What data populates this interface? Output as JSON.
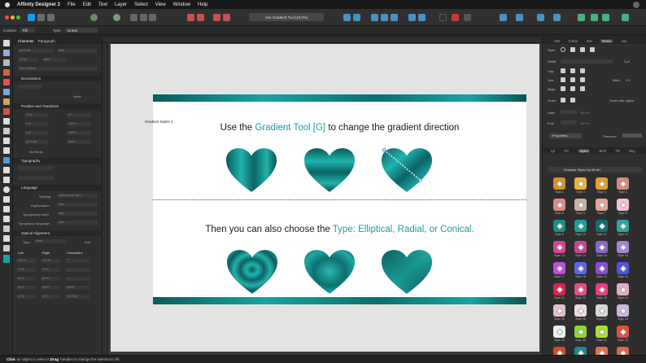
{
  "menubar": {
    "app_name": "Affinity Designer 2",
    "items": [
      "File",
      "Edit",
      "Text",
      "Layer",
      "Select",
      "View",
      "Window",
      "Help"
    ]
  },
  "toolbar": {
    "document_title": "Use Gradient Tool [19.0%]"
  },
  "context_toolbar": {
    "context_label": "Context:",
    "context_value": "Fill",
    "type_label": "Type:",
    "type_value": "Linear"
  },
  "left_panel": {
    "tabs": [
      "Character",
      "Paragraph"
    ],
    "font_family": "All Fonts",
    "font_style": "Arial",
    "font_size": "24 pt",
    "font_weight": "Bold",
    "no_shadow": "[No Shadow]",
    "sections": {
      "decorations": "Decorations",
      "position": "Position and Transform",
      "typography": "Typography",
      "language": "Language",
      "optical": "Optical Alignment"
    },
    "decoration_none": "None",
    "position_rows": [
      {
        "a": "10 %",
        "b": "0 °"
      },
      {
        "a": "0 %",
        "b": "100 %"
      },
      {
        "a": "0 pt",
        "b": "100 %"
      },
      {
        "a": "(24.6 pt)",
        "b": "None"
      }
    ],
    "no_break": "No Break",
    "language_rows": [
      {
        "label": "Spelling:",
        "value": "Unknown (en-NL)"
      },
      {
        "label": "Hyphenation:",
        "value": "Auto"
      },
      {
        "label": "Typography script:",
        "value": "Auto"
      },
      {
        "label": "Typography language:",
        "value": "Auto"
      }
    ],
    "optical_type_label": "Type:",
    "optical_type_value": "None",
    "optical_add": "Add",
    "optical_headers": [
      "Left",
      "Right",
      "Characters"
    ],
    "optical_rows": [
      {
        "l": "100 %",
        "r": "100 %",
        "c": "“”‘’"
      },
      {
        "l": "70 %",
        "r": "70 %",
        "c": "–"
      },
      {
        "l": "50 %",
        "r": "50 %",
        "c": "—"
      },
      {
        "l": "25 %",
        "r": "25 %",
        "c": "ATWY"
      },
      {
        "l": "20 %",
        "r": "20 %",
        "c": "COOQQ"
      }
    ]
  },
  "canvas": {
    "artboard_label": "Gradient Styles 1",
    "headline1": {
      "pre": "Use the ",
      "highlight": "Gradient Tool [G]",
      "post": " to change the gradient direction"
    },
    "headline2": {
      "pre": "Then you can also choose the ",
      "highlight": "Type: Elliptical, Radial, or Conical."
    },
    "colors": {
      "teal": "#1b9c9b",
      "dark_teal": "#0b5c5c"
    }
  },
  "right_panel": {
    "top_tabs": [
      "Hist",
      "Colour",
      "Swt",
      "Stroke",
      "Apr"
    ],
    "style_label": "Style:",
    "width_label": "Width:",
    "width_value": "3 pt",
    "cap_label": "Cap:",
    "join_label": "Join:",
    "mitre_label": "Mitre:",
    "mitre_value": "1.5",
    "align_label": "Align:",
    "order_label": "Order:",
    "scale_with_object": "Scale with object",
    "start_label": "Start:",
    "end_label": "End:",
    "start_pct": "100 %",
    "end_pct": "100 %",
    "properties": "Properties...",
    "pressure": "Pressure:",
    "bottom_tabs": [
      "Lyr",
      "FX",
      "Styles",
      "Brsh",
      "Tfn",
      "Nvg"
    ],
    "gradient_styles_title": "Gradient Styles by AfLArt",
    "swatches": [
      {
        "name": "Style 1",
        "color": "#d8902a"
      },
      {
        "name": "Style 2",
        "color": "#e7b43a"
      },
      {
        "name": "Style 3",
        "color": "#e2a030"
      },
      {
        "name": "Style 4",
        "color": "#d98a7a"
      },
      {
        "name": "Style 5",
        "color": "#d98b8b"
      },
      {
        "name": "Style 6",
        "color": "#c9b0a0"
      },
      {
        "name": "Style 7",
        "color": "#e0a596"
      },
      {
        "name": "Style 8",
        "color": "#f2c0d0"
      },
      {
        "name": "Style 9",
        "color": "#1a8c8c"
      },
      {
        "name": "Style 10",
        "color": "#15a09c"
      },
      {
        "name": "Style 11",
        "color": "#0f6f6f"
      },
      {
        "name": "Style 12",
        "color": "#25a8a0"
      },
      {
        "name": "Style 13",
        "color": "#d6449a"
      },
      {
        "name": "Style 14",
        "color": "#c74595"
      },
      {
        "name": "Style 15",
        "color": "#8a66c8"
      },
      {
        "name": "Style 16",
        "color": "#9f86d8"
      },
      {
        "name": "Style 17",
        "color": "#c04be0"
      },
      {
        "name": "Style 18",
        "color": "#5b68e8"
      },
      {
        "name": "Style 19",
        "color": "#8a4ad8"
      },
      {
        "name": "Style 20",
        "color": "#4b55e0"
      },
      {
        "name": "Style 21",
        "color": "#e0204e"
      },
      {
        "name": "Style 22",
        "color": "#e84a8a"
      },
      {
        "name": "Style 23",
        "color": "#ee3a80"
      },
      {
        "name": "Style 24",
        "color": "#e8a8c8"
      },
      {
        "name": "Style 25",
        "color": "#e5c0c8"
      },
      {
        "name": "Style 26",
        "color": "#f0d8e0"
      },
      {
        "name": "Style 27",
        "color": "#d8d8d8"
      },
      {
        "name": "Style 28",
        "color": "#c8b8e0"
      },
      {
        "name": "Style 29",
        "color": "#e8f0f0"
      },
      {
        "name": "Style 30",
        "color": "#8ad830"
      },
      {
        "name": "Style 31",
        "color": "#a8e030"
      },
      {
        "name": "Style 32",
        "color": "#e05040"
      },
      {
        "name": "",
        "color": "#d04a30"
      },
      {
        "name": "",
        "color": "#1c8a8a"
      },
      {
        "name": "",
        "color": "#e07050"
      },
      {
        "name": "",
        "color": "#e06048"
      }
    ]
  },
  "status_bar": {
    "click": "Click",
    "text1": " an object to select it. ",
    "drag": "Drag",
    "text2": " handles to change the selection's fill."
  }
}
